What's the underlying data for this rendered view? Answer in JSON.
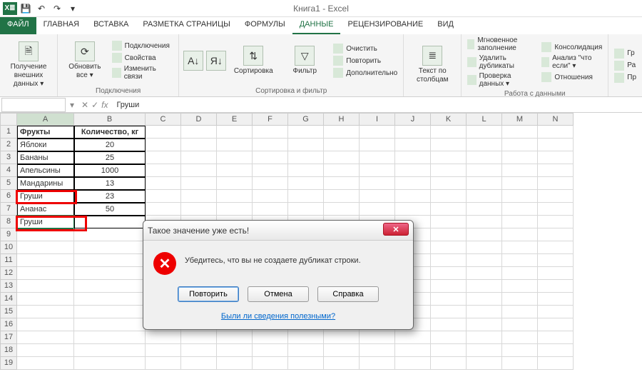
{
  "title": "Книга1 - Excel",
  "qat": {
    "save": "💾",
    "undo": "↶",
    "redo": "↷"
  },
  "tabs": {
    "file": "ФАЙЛ",
    "items": [
      "ГЛАВНАЯ",
      "ВСТАВКА",
      "РАЗМЕТКА СТРАНИЦЫ",
      "ФОРМУЛЫ",
      "ДАННЫЕ",
      "РЕЦЕНЗИРОВАНИЕ",
      "ВИД"
    ],
    "active_index": 4
  },
  "ribbon": {
    "groups": [
      {
        "label": "",
        "big": [
          {
            "text": "Получение внешних данных ▾"
          }
        ]
      },
      {
        "label": "Подключения",
        "big": [
          {
            "text": "Обновить все ▾"
          }
        ],
        "small": [
          "Подключения",
          "Свойства",
          "Изменить связи"
        ]
      },
      {
        "label": "Сортировка и фильтр",
        "big": [
          {
            "text": "А↓Я"
          },
          {
            "text": "Я↓А"
          },
          {
            "text": "Сортировка"
          },
          {
            "text": "Фильтр"
          }
        ],
        "small": [
          "Очистить",
          "Повторить",
          "Дополнительно"
        ]
      },
      {
        "label": "",
        "big": [
          {
            "text": "Текст по столбцам"
          }
        ]
      },
      {
        "label": "Работа с данными",
        "small": [
          "Мгновенное заполнение",
          "Удалить дубликаты",
          "Проверка данных ▾",
          "Консолидация",
          "Анализ \"что если\" ▾",
          "Отношения"
        ]
      },
      {
        "label": "",
        "small": [
          "Гр",
          "Ра",
          "Пр"
        ]
      }
    ]
  },
  "formula_bar": {
    "name_box": "",
    "value": "Груши",
    "fx": "fx"
  },
  "columns": [
    "A",
    "B",
    "C",
    "D",
    "E",
    "F",
    "G",
    "H",
    "I",
    "J",
    "K",
    "L",
    "M",
    "N"
  ],
  "sheet": {
    "headers": [
      "Фрукты",
      "Количество, кг"
    ],
    "rows": [
      [
        "Яблоки",
        "20"
      ],
      [
        "Бананы",
        "25"
      ],
      [
        "Апельсины",
        "1000"
      ],
      [
        "Мандарины",
        "13"
      ],
      [
        "Груши",
        "23"
      ],
      [
        "Ананас",
        "50"
      ],
      [
        "Груши",
        ""
      ]
    ],
    "active_cell": "A8",
    "highlighted_rows": [
      6,
      8
    ]
  },
  "dialog": {
    "title": "Такое значение уже есть!",
    "message": "Убедитесь, что вы не создаете дубликат строки.",
    "buttons": {
      "retry": "Повторить",
      "cancel": "Отмена",
      "help": "Справка"
    },
    "feedback_link": "Были ли сведения полезными?"
  }
}
